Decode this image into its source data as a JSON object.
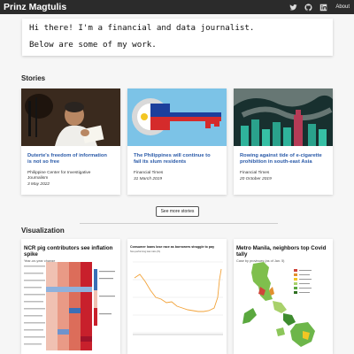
{
  "nav": {
    "brand": "Prinz Magtulis",
    "about": "About"
  },
  "intro": {
    "line1": "Hi there! I'm a financial and data journalist.",
    "line2": "Below are some of my work."
  },
  "sections": {
    "stories": "Stories",
    "visualization": "Visualization"
  },
  "stories": [
    {
      "title": "Duterte's freedom of information is not so free",
      "publisher": "Philippine Center for Investigative Journalism",
      "date": "3 May 2022"
    },
    {
      "title": "The Philippines will continue to fail its slum residents",
      "publisher": "Financial Times",
      "date": "31 March 2019"
    },
    {
      "title": "Rowing against tide of e-cigarette prohibition in south-east Asia",
      "publisher": "Financial Times",
      "date": "20 October 2019"
    }
  ],
  "see_more": "See more stories",
  "visualizations": [
    {
      "title": "NCR pig contributors see inflation spike",
      "subtitle": "Year-on-year change"
    },
    {
      "title": "Consumer loans lose race as borrowers struggle to pay",
      "subtitle": "Non-performing loan ratio (%)"
    },
    {
      "title": "Metro Manila, neighbors top Covid tally",
      "subtitle": "Case by provinces (as of Jan. 5)"
    }
  ],
  "colors": {
    "navbar": "#2b2b2b",
    "link": "#2a5aa8",
    "heat_red": "#c8202c",
    "heat_blue": "#3b6fb6",
    "map_green": "#7fbf4d",
    "line_orange": "#f2a33a"
  }
}
